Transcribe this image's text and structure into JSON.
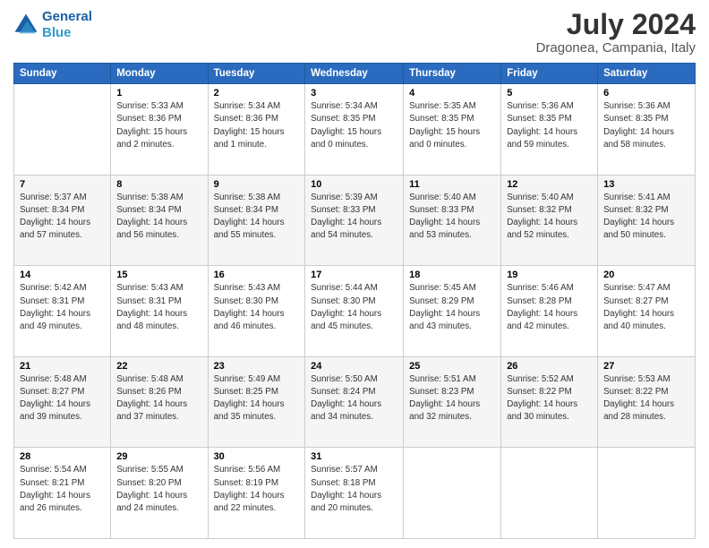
{
  "header": {
    "logo_line1": "General",
    "logo_line2": "Blue",
    "month_year": "July 2024",
    "location": "Dragonea, Campania, Italy"
  },
  "weekdays": [
    "Sunday",
    "Monday",
    "Tuesday",
    "Wednesday",
    "Thursday",
    "Friday",
    "Saturday"
  ],
  "weeks": [
    [
      {
        "day": "",
        "info": ""
      },
      {
        "day": "1",
        "info": "Sunrise: 5:33 AM\nSunset: 8:36 PM\nDaylight: 15 hours\nand 2 minutes."
      },
      {
        "day": "2",
        "info": "Sunrise: 5:34 AM\nSunset: 8:36 PM\nDaylight: 15 hours\nand 1 minute."
      },
      {
        "day": "3",
        "info": "Sunrise: 5:34 AM\nSunset: 8:35 PM\nDaylight: 15 hours\nand 0 minutes."
      },
      {
        "day": "4",
        "info": "Sunrise: 5:35 AM\nSunset: 8:35 PM\nDaylight: 15 hours\nand 0 minutes."
      },
      {
        "day": "5",
        "info": "Sunrise: 5:36 AM\nSunset: 8:35 PM\nDaylight: 14 hours\nand 59 minutes."
      },
      {
        "day": "6",
        "info": "Sunrise: 5:36 AM\nSunset: 8:35 PM\nDaylight: 14 hours\nand 58 minutes."
      }
    ],
    [
      {
        "day": "7",
        "info": "Sunrise: 5:37 AM\nSunset: 8:34 PM\nDaylight: 14 hours\nand 57 minutes."
      },
      {
        "day": "8",
        "info": "Sunrise: 5:38 AM\nSunset: 8:34 PM\nDaylight: 14 hours\nand 56 minutes."
      },
      {
        "day": "9",
        "info": "Sunrise: 5:38 AM\nSunset: 8:34 PM\nDaylight: 14 hours\nand 55 minutes."
      },
      {
        "day": "10",
        "info": "Sunrise: 5:39 AM\nSunset: 8:33 PM\nDaylight: 14 hours\nand 54 minutes."
      },
      {
        "day": "11",
        "info": "Sunrise: 5:40 AM\nSunset: 8:33 PM\nDaylight: 14 hours\nand 53 minutes."
      },
      {
        "day": "12",
        "info": "Sunrise: 5:40 AM\nSunset: 8:32 PM\nDaylight: 14 hours\nand 52 minutes."
      },
      {
        "day": "13",
        "info": "Sunrise: 5:41 AM\nSunset: 8:32 PM\nDaylight: 14 hours\nand 50 minutes."
      }
    ],
    [
      {
        "day": "14",
        "info": "Sunrise: 5:42 AM\nSunset: 8:31 PM\nDaylight: 14 hours\nand 49 minutes."
      },
      {
        "day": "15",
        "info": "Sunrise: 5:43 AM\nSunset: 8:31 PM\nDaylight: 14 hours\nand 48 minutes."
      },
      {
        "day": "16",
        "info": "Sunrise: 5:43 AM\nSunset: 8:30 PM\nDaylight: 14 hours\nand 46 minutes."
      },
      {
        "day": "17",
        "info": "Sunrise: 5:44 AM\nSunset: 8:30 PM\nDaylight: 14 hours\nand 45 minutes."
      },
      {
        "day": "18",
        "info": "Sunrise: 5:45 AM\nSunset: 8:29 PM\nDaylight: 14 hours\nand 43 minutes."
      },
      {
        "day": "19",
        "info": "Sunrise: 5:46 AM\nSunset: 8:28 PM\nDaylight: 14 hours\nand 42 minutes."
      },
      {
        "day": "20",
        "info": "Sunrise: 5:47 AM\nSunset: 8:27 PM\nDaylight: 14 hours\nand 40 minutes."
      }
    ],
    [
      {
        "day": "21",
        "info": "Sunrise: 5:48 AM\nSunset: 8:27 PM\nDaylight: 14 hours\nand 39 minutes."
      },
      {
        "day": "22",
        "info": "Sunrise: 5:48 AM\nSunset: 8:26 PM\nDaylight: 14 hours\nand 37 minutes."
      },
      {
        "day": "23",
        "info": "Sunrise: 5:49 AM\nSunset: 8:25 PM\nDaylight: 14 hours\nand 35 minutes."
      },
      {
        "day": "24",
        "info": "Sunrise: 5:50 AM\nSunset: 8:24 PM\nDaylight: 14 hours\nand 34 minutes."
      },
      {
        "day": "25",
        "info": "Sunrise: 5:51 AM\nSunset: 8:23 PM\nDaylight: 14 hours\nand 32 minutes."
      },
      {
        "day": "26",
        "info": "Sunrise: 5:52 AM\nSunset: 8:22 PM\nDaylight: 14 hours\nand 30 minutes."
      },
      {
        "day": "27",
        "info": "Sunrise: 5:53 AM\nSunset: 8:22 PM\nDaylight: 14 hours\nand 28 minutes."
      }
    ],
    [
      {
        "day": "28",
        "info": "Sunrise: 5:54 AM\nSunset: 8:21 PM\nDaylight: 14 hours\nand 26 minutes."
      },
      {
        "day": "29",
        "info": "Sunrise: 5:55 AM\nSunset: 8:20 PM\nDaylight: 14 hours\nand 24 minutes."
      },
      {
        "day": "30",
        "info": "Sunrise: 5:56 AM\nSunset: 8:19 PM\nDaylight: 14 hours\nand 22 minutes."
      },
      {
        "day": "31",
        "info": "Sunrise: 5:57 AM\nSunset: 8:18 PM\nDaylight: 14 hours\nand 20 minutes."
      },
      {
        "day": "",
        "info": ""
      },
      {
        "day": "",
        "info": ""
      },
      {
        "day": "",
        "info": ""
      }
    ]
  ]
}
